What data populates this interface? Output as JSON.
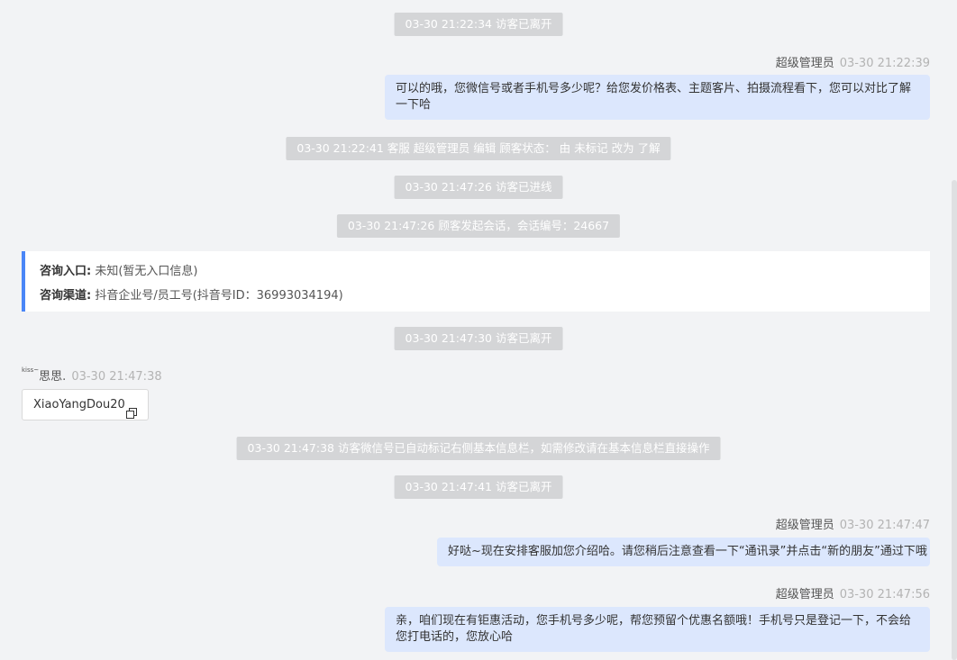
{
  "system_messages": [
    "03-30 21:22:34 访客已离开",
    "03-30 21:22:41 客服 超级管理员 编辑 顾客状态： 由 未标记 改为 了解",
    "03-30 21:47:26 访客已进线",
    "03-30 21:47:26 顾客发起会话，会话编号：24667",
    "03-30 21:47:30 访客已离开",
    "03-30 21:47:38 访客微信号已自动标记右侧基本信息栏，如需修改请在基本信息栏直接操作",
    "03-30 21:47:41 访客已离开"
  ],
  "agent_messages": [
    {
      "sender": "超级管理员",
      "time": "03-30 21:22:39",
      "lines": [
        "可以的哦，您微信号或者手机号多少呢？给您发价格表、主题客片、拍摄流程看下，您可以对比了解",
        "一下哈"
      ]
    },
    {
      "sender": "超级管理员",
      "time": "03-30 21:47:47",
      "lines": [
        "好哒~现在安排客服加您介绍哈。请您稍后注意查看一下“通讯录”并点击“新的朋友”通过下哦"
      ]
    },
    {
      "sender": "超级管理员",
      "time": "03-30 21:47:56",
      "lines": [
        "亲，咱们现在有钜惠活动，您手机号多少呢，帮您预留个优惠名额哦！手机号只是登记一下，不会给",
        "您打电话的，您放心哈"
      ]
    }
  ],
  "consult_info": {
    "entry_label": "咨询入口:",
    "entry_value": "未知(暂无入口信息)",
    "channel_label": "咨询渠道:",
    "channel_value": "抖音企业号/员工号(抖音号ID：36993034194)"
  },
  "visitor_message": {
    "sender_prefix": "kiss~",
    "sender": "思思.",
    "time": "03-30 21:47:38",
    "wechat": "XiaoYangDou20",
    "copy_icon": "copy-icon"
  },
  "colors": {
    "background": "#f2f3f5",
    "system_pill": "#d4d5d7",
    "agent_bubble": "#dce7fd",
    "info_accent": "#4a86f7"
  }
}
